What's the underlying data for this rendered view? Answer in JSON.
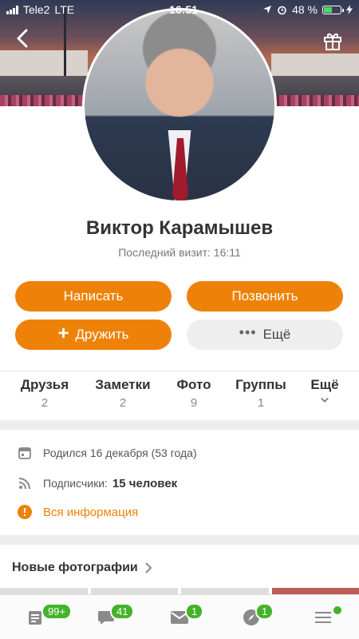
{
  "status_bar": {
    "carrier": "Tele2",
    "network": "LTE",
    "time": "16:51",
    "battery_percent": "48 %",
    "battery_level": 0.48
  },
  "profile": {
    "name": "Виктор Карамышев",
    "last_visit": "Последний визит: 16:11"
  },
  "actions": {
    "write": "Написать",
    "call": "Позвонить",
    "friend": "Дружить",
    "more": "Ещё"
  },
  "tabs": [
    {
      "label": "Друзья",
      "count": "2"
    },
    {
      "label": "Заметки",
      "count": "2"
    },
    {
      "label": "Фото",
      "count": "9"
    },
    {
      "label": "Группы",
      "count": "1"
    },
    {
      "label": "Ещё"
    }
  ],
  "info": {
    "birth": "Родился 16 декабря (53 года)",
    "subscribers_label": "Подписчики:",
    "subscribers_value": "15 человек",
    "all_info": "Вся информация"
  },
  "sections": {
    "new_photos": "Новые фотографии"
  },
  "bottom_nav": {
    "feed_badge": "99+",
    "messages_badge": "41",
    "mail_badge": "1",
    "discover_badge": "1"
  },
  "colors": {
    "accent": "#ee8208",
    "badge": "#43b32a"
  }
}
